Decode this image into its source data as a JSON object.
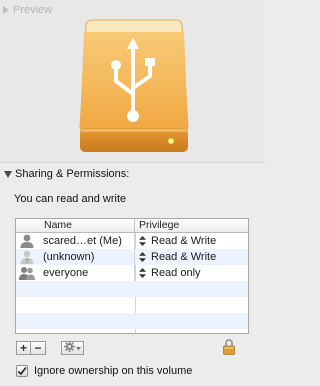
{
  "preview": {
    "title": "Preview"
  },
  "sharing": {
    "title": "Sharing & Permissions:",
    "summary": "You can read and write",
    "columns": {
      "name": "Name",
      "privilege": "Privilege"
    },
    "rows": [
      {
        "name": "scared…et (Me)",
        "privilege": "Read & Write",
        "icon": "single-user-icon"
      },
      {
        "name": "(unknown)",
        "privilege": "Read & Write",
        "icon": "unknown-user-icon"
      },
      {
        "name": "everyone",
        "privilege": "Read only",
        "icon": "group-users-icon"
      }
    ]
  },
  "toolbar": {
    "add_label": "+",
    "remove_label": "−"
  },
  "ignore_ownership": {
    "label": "Ignore ownership on this volume",
    "checked": true
  },
  "colors": {
    "drive_top": "#f9dc9f",
    "drive_body": "#f3b24e",
    "stripe": "#edf3fe",
    "led": "#e4f05a"
  }
}
